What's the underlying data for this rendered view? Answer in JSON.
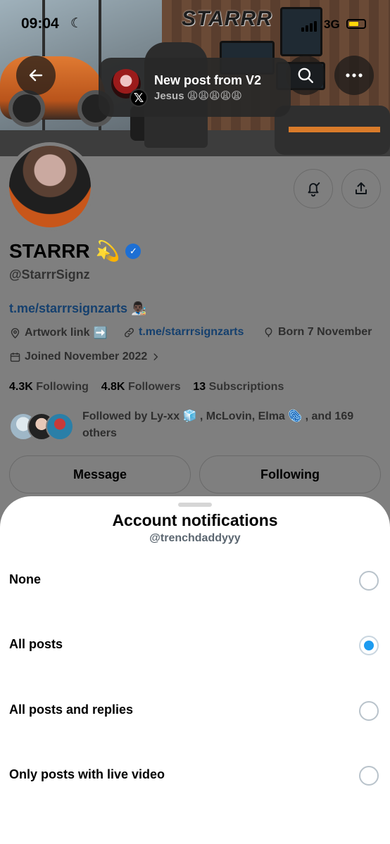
{
  "status_bar": {
    "time": "09:04",
    "network": "3G"
  },
  "banner": {
    "sign_text": "STARRR"
  },
  "toast": {
    "title": "New post from V2",
    "body": "Jesus 😩😩😩😩😩",
    "app_badge": "𝕏"
  },
  "profile": {
    "name": "STARRR",
    "name_emoji": "💫",
    "handle": "@StarrrSignz",
    "bio_link": "t.me/starrrsignzarts",
    "bio_emoji": "👨🏿‍🎨",
    "meta": {
      "artwork_label": "Artwork link",
      "artwork_emoji": "➡️",
      "link": "t.me/starrrsignzarts",
      "born": "Born 7 November",
      "joined": "Joined November 2022"
    },
    "stats": {
      "following_count": "4.3K",
      "following_label": "Following",
      "followers_count": "4.8K",
      "followers_label": "Followers",
      "subscriptions_count": "13",
      "subscriptions_label": "Subscriptions"
    },
    "followed_by": "Followed by Ly-xx 🧊 , McLovin, Elma 🫆 , and 169 others",
    "message_button": "Message",
    "following_button": "Following"
  },
  "sheet": {
    "title": "Account notifications",
    "subtitle": "@trenchdaddyyy",
    "options": [
      {
        "label": "None",
        "selected": false
      },
      {
        "label": "All posts",
        "selected": true
      },
      {
        "label": "All posts and replies",
        "selected": false
      },
      {
        "label": "Only posts with live video",
        "selected": false
      }
    ]
  },
  "colors": {
    "accent": "#1d9bf0",
    "verified": "#1d6fd4",
    "overlay": "#7f7f7f"
  },
  "icons": [
    "back-arrow-icon",
    "search-icon",
    "more-icon",
    "bell-check-icon",
    "share-icon",
    "location-icon",
    "link-icon",
    "balloon-icon",
    "calendar-icon",
    "chevron-right-icon",
    "verified-icon",
    "moon-icon",
    "signal-icon",
    "battery-icon"
  ]
}
